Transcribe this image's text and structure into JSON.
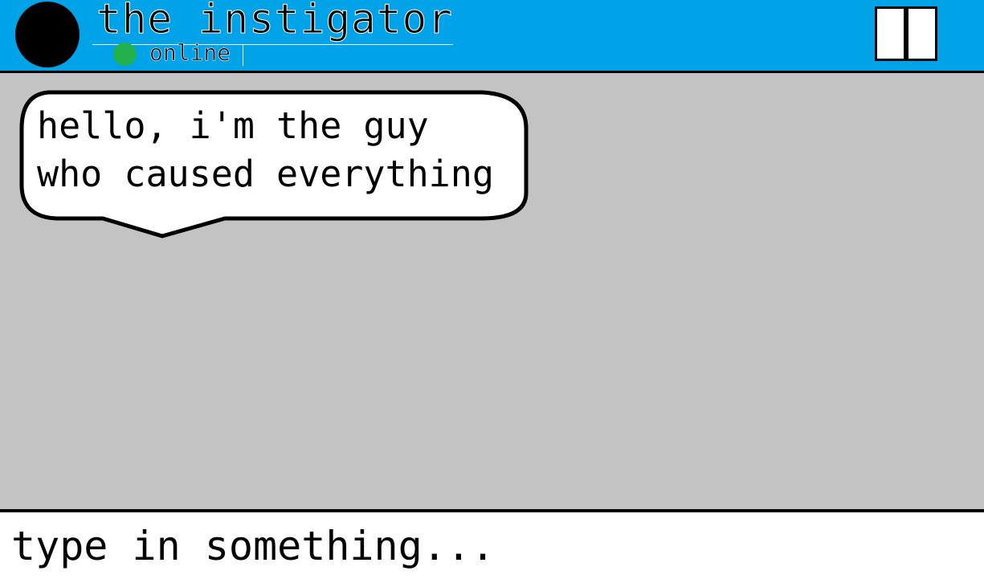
{
  "contact": {
    "name": "the instigator",
    "status": "online",
    "status_color": "#22b14c"
  },
  "header": {
    "background_color": "#00a2e8",
    "menu_icon": "panel-toggle-icon"
  },
  "messages": [
    {
      "line1": "hello, i'm the guy",
      "line2": "who caused everything"
    }
  ],
  "composer": {
    "placeholder": "type in something..."
  }
}
